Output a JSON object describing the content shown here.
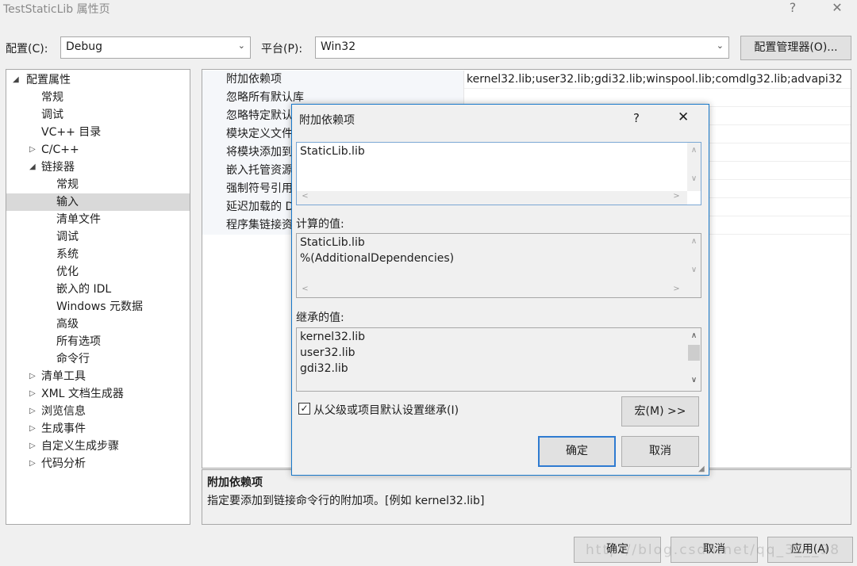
{
  "window": {
    "title": "TestStaticLib 属性页",
    "help_glyph": "?",
    "close_glyph": "✕"
  },
  "toolbar": {
    "config_label": "配置(C):",
    "config_value": "Debug",
    "platform_label": "平台(P):",
    "platform_value": "Win32",
    "config_manager_button": "配置管理器(O)..."
  },
  "tree": {
    "items": [
      {
        "label": "配置属性",
        "indent": 0,
        "toggle": "expanded"
      },
      {
        "label": "常规",
        "indent": 1,
        "toggle": "none"
      },
      {
        "label": "调试",
        "indent": 1,
        "toggle": "none"
      },
      {
        "label": "VC++ 目录",
        "indent": 1,
        "toggle": "none"
      },
      {
        "label": "C/C++",
        "indent": 1,
        "toggle": "collapsed"
      },
      {
        "label": "链接器",
        "indent": 1,
        "toggle": "expanded"
      },
      {
        "label": "常规",
        "indent": 2,
        "toggle": "none"
      },
      {
        "label": "输入",
        "indent": 2,
        "toggle": "none",
        "selected": true
      },
      {
        "label": "清单文件",
        "indent": 2,
        "toggle": "none"
      },
      {
        "label": "调试",
        "indent": 2,
        "toggle": "none"
      },
      {
        "label": "系统",
        "indent": 2,
        "toggle": "none"
      },
      {
        "label": "优化",
        "indent": 2,
        "toggle": "none"
      },
      {
        "label": "嵌入的 IDL",
        "indent": 2,
        "toggle": "none"
      },
      {
        "label": "Windows 元数据",
        "indent": 2,
        "toggle": "none"
      },
      {
        "label": "高级",
        "indent": 2,
        "toggle": "none"
      },
      {
        "label": "所有选项",
        "indent": 2,
        "toggle": "none"
      },
      {
        "label": "命令行",
        "indent": 2,
        "toggle": "none"
      },
      {
        "label": "清单工具",
        "indent": 1,
        "toggle": "collapsed"
      },
      {
        "label": "XML 文档生成器",
        "indent": 1,
        "toggle": "collapsed"
      },
      {
        "label": "浏览信息",
        "indent": 1,
        "toggle": "collapsed"
      },
      {
        "label": "生成事件",
        "indent": 1,
        "toggle": "collapsed"
      },
      {
        "label": "自定义生成步骤",
        "indent": 1,
        "toggle": "collapsed"
      },
      {
        "label": "代码分析",
        "indent": 1,
        "toggle": "collapsed"
      }
    ]
  },
  "grid": {
    "rows": [
      {
        "name": "附加依赖项",
        "value": "kernel32.lib;user32.lib;gdi32.lib;winspool.lib;comdlg32.lib;advapi32"
      },
      {
        "name": "忽略所有默认库",
        "value": ""
      },
      {
        "name": "忽略特定默认",
        "value": ""
      },
      {
        "name": "模块定义文件",
        "value": ""
      },
      {
        "name": "将模块添加到",
        "value": ""
      },
      {
        "name": "嵌入托管资源",
        "value": ""
      },
      {
        "name": "强制符号引用",
        "value": ""
      },
      {
        "name": "延迟加载的 D",
        "value": ""
      },
      {
        "name": "程序集链接资",
        "value": ""
      }
    ]
  },
  "description": {
    "title": "附加依赖项",
    "text": "指定要添加到链接命令行的附加项。[例如 kernel32.lib]"
  },
  "footer": {
    "ok": "确定",
    "cancel": "取消",
    "apply": "应用(A)",
    "watermark": "http://blog.csdn.net/qq_3___98"
  },
  "dialog": {
    "title": "附加依赖项",
    "help_glyph": "?",
    "close_glyph": "✕",
    "edit_lines": [
      "StaticLib.lib"
    ],
    "computed_label": "计算的值:",
    "computed_lines": [
      "StaticLib.lib",
      "%(AdditionalDependencies)"
    ],
    "inherited_label": "继承的值:",
    "inherited_lines": [
      "kernel32.lib",
      "user32.lib",
      "gdi32.lib"
    ],
    "inherit_checkbox_label": "从父级或项目默认设置继承(I)",
    "inherit_checked": true,
    "macro_button": "宏(M) >>",
    "ok_button": "确定",
    "cancel_button": "取消"
  }
}
